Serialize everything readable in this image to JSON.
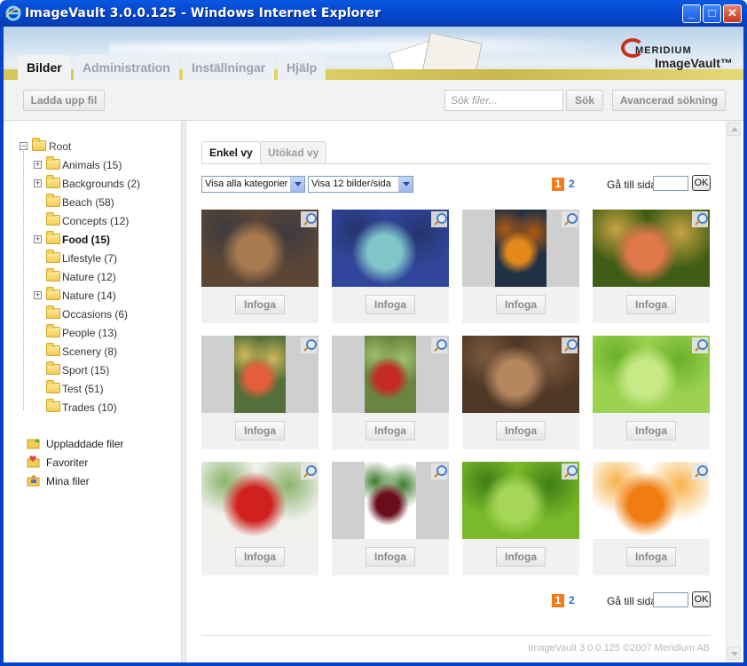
{
  "window": {
    "title": "ImageVault 3.0.0.125 - Windows Internet Explorer",
    "min_label": "_",
    "max_label": "□",
    "close_label": "✕"
  },
  "logo": {
    "brand": "MERIDIUM",
    "product": "ImageVault™"
  },
  "main_tabs": [
    {
      "label": "Bilder",
      "active": true
    },
    {
      "label": "Administration",
      "active": false
    },
    {
      "label": "Inställningar",
      "active": false
    },
    {
      "label": "Hjälp",
      "active": false
    }
  ],
  "toolbar": {
    "upload_label": "Ladda upp fil",
    "search_placeholder": "Sök filer...",
    "search_label": "Sök",
    "advanced_label": "Avancerad sökning"
  },
  "tree": {
    "root_label": "Root",
    "items": [
      {
        "label": "Animals (15)",
        "expandable": true,
        "bold": false
      },
      {
        "label": "Backgrounds (2)",
        "expandable": true,
        "bold": false
      },
      {
        "label": "Beach (58)",
        "expandable": false,
        "bold": false
      },
      {
        "label": "Concepts (12)",
        "expandable": false,
        "bold": false
      },
      {
        "label": "Food (15)",
        "expandable": true,
        "bold": true
      },
      {
        "label": "Lifestyle (7)",
        "expandable": false,
        "bold": false
      },
      {
        "label": "Nature (12)",
        "expandable": false,
        "bold": false
      },
      {
        "label": "Nature (14)",
        "expandable": true,
        "bold": false
      },
      {
        "label": "Occasions (6)",
        "expandable": false,
        "bold": false
      },
      {
        "label": "People (13)",
        "expandable": false,
        "bold": false
      },
      {
        "label": "Scenery (8)",
        "expandable": false,
        "bold": false
      },
      {
        "label": "Sport (15)",
        "expandable": false,
        "bold": false
      },
      {
        "label": "Test (51)",
        "expandable": false,
        "bold": false
      },
      {
        "label": "Trades (10)",
        "expandable": false,
        "bold": false
      }
    ],
    "expander_symbol": "+",
    "collapser_symbol": "−"
  },
  "special": [
    {
      "label": "Uppladdade filer",
      "icon": "uploaded-files-icon"
    },
    {
      "label": "Favoriter",
      "icon": "favorites-icon"
    },
    {
      "label": "Mina filer",
      "icon": "my-files-icon"
    }
  ],
  "view_tabs": [
    {
      "label": "Enkel vy",
      "active": true
    },
    {
      "label": "Utökad vy",
      "active": false
    }
  ],
  "filters": {
    "category": "Visa alla kategorier",
    "per_page": "Visa 12 bilder/sida"
  },
  "pager": {
    "current": "1",
    "next": "2",
    "goto_label": "Gå till sida",
    "ok_label": "OK"
  },
  "thumbnails": {
    "insert_label": "Infoga",
    "items": [
      {
        "subject": "gingerbread cookies",
        "colors": [
          "#5b4636",
          "#a77a4f",
          "#3c3b3f"
        ]
      },
      {
        "subject": "blueberries",
        "colors": [
          "#31469a",
          "#7fc5c9",
          "#25346f"
        ]
      },
      {
        "subject": "pumpkins",
        "colors": [
          "#213144",
          "#e3891a",
          "#b05a10"
        ]
      },
      {
        "subject": "apples",
        "colors": [
          "#3f5d15",
          "#e0784a",
          "#c8a243"
        ]
      },
      {
        "subject": "apples on branch",
        "colors": [
          "#54703a",
          "#e55d3a",
          "#d0b85b"
        ]
      },
      {
        "subject": "red apples",
        "colors": [
          "#6a8540",
          "#c52a24",
          "#9ec06b"
        ]
      },
      {
        "subject": "potatoes",
        "colors": [
          "#4e3725",
          "#b6875f",
          "#7d5a3e"
        ]
      },
      {
        "subject": "celery",
        "colors": [
          "#9bd24f",
          "#c7ea87",
          "#6bb028"
        ]
      },
      {
        "subject": "red currants",
        "colors": [
          "#f0f0ec",
          "#d0211e",
          "#8bb46a"
        ]
      },
      {
        "subject": "cherry",
        "colors": [
          "#ffffff",
          "#6a0d1a",
          "#3e7a2c"
        ]
      },
      {
        "subject": "green berries",
        "colors": [
          "#7aba2a",
          "#a5d658",
          "#3f7d17"
        ]
      },
      {
        "subject": "orange slices",
        "colors": [
          "#ffffff",
          "#f07c12",
          "#f7b34c"
        ]
      }
    ]
  },
  "footer": {
    "text": "ImageVault 3.0.0.125 ©2007 Meridium AB"
  }
}
